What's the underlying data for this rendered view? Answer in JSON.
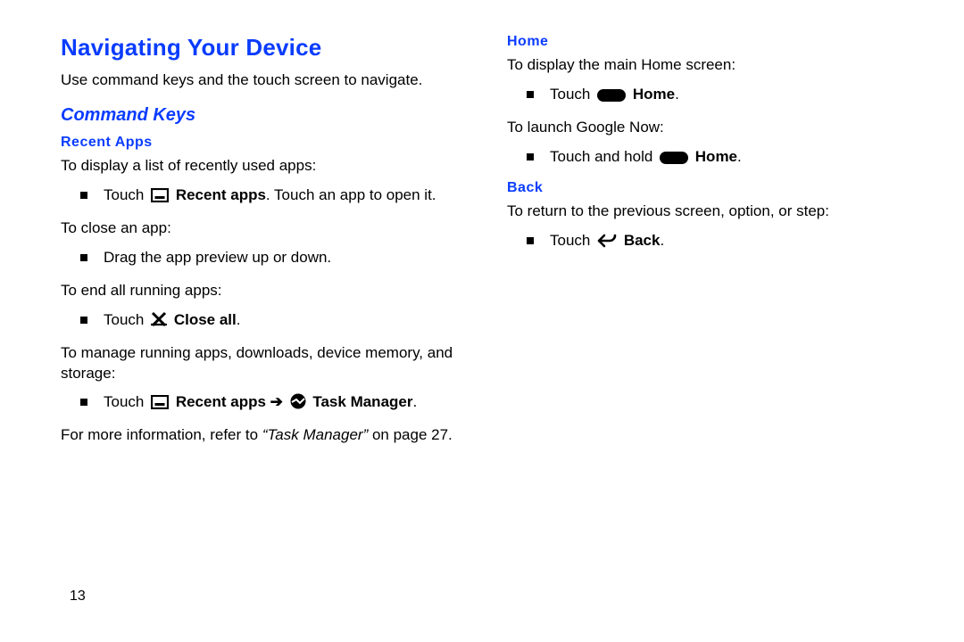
{
  "title": "Navigating Your Device",
  "intro": "Use command keys and the touch screen to navigate.",
  "cmd_heading": "Command Keys",
  "col1": {
    "recent_apps": {
      "heading": "Recent Apps",
      "p1": "To display a list of recently used apps:",
      "b1_pre": "Touch ",
      "b1_bold": "Recent apps",
      "b1_post": ". Touch an app to open it.",
      "p2": "To close an app:",
      "b2": "Drag the app preview up or down.",
      "p3": "To end all running apps:",
      "b3_pre": "Touch ",
      "b3_bold": "Close all",
      "b3_post": ".",
      "p4": "To manage running apps, downloads, device memory, and storage:",
      "b4_pre": "Touch ",
      "b4_bold1": "Recent apps",
      "b4_arrow": " ➔ ",
      "b4_bold2": "Task Manager",
      "b4_post": ".",
      "ref_pre": "For more information, refer to ",
      "ref_italic": "“Task Manager”",
      "ref_post": " on page 27."
    }
  },
  "col2": {
    "home": {
      "heading": "Home",
      "p1": "To display the main Home screen:",
      "b1_pre": "Touch ",
      "b1_bold": "Home",
      "b1_post": ".",
      "p2": "To launch Google Now:",
      "b2_pre": "Touch and hold ",
      "b2_bold": "Home",
      "b2_post": "."
    },
    "back": {
      "heading": "Back",
      "p1": "To return to the previous screen, option, or step:",
      "b1_pre": "Touch ",
      "b1_bold": "Back",
      "b1_post": "."
    }
  },
  "page_number": "13"
}
